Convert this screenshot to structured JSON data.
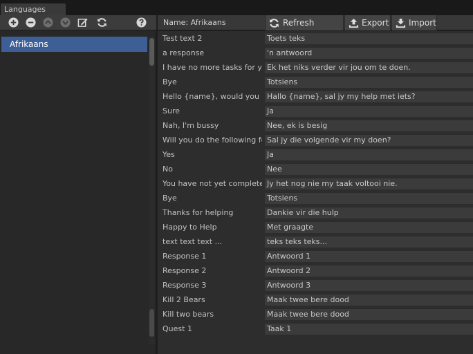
{
  "window": {
    "tab_label": "Languages"
  },
  "left_toolbar": {
    "icons": [
      "add-icon",
      "remove-icon",
      "move-up-icon",
      "move-down-icon",
      "edit-icon",
      "refresh-icon",
      "help-icon"
    ]
  },
  "languages": [
    "Afrikaans"
  ],
  "header": {
    "name_label": "Name:  Afrikaans",
    "refresh_label": "Refresh Strings",
    "export_label": "Export",
    "import_label": "Import"
  },
  "rows": [
    {
      "key": "Test text 2",
      "value": "Toets teks"
    },
    {
      "key": "a response",
      "value": "'n antwoord"
    },
    {
      "key": "I have no more tasks for you to do.",
      "value": "Ek het niks verder vir jou om te doen."
    },
    {
      "key": "Bye",
      "value": "Totsiens"
    },
    {
      "key": "Hello {name}, would you help me with something?",
      "value": "Hallo {name}, sal jy my help met iets?"
    },
    {
      "key": "Sure",
      "value": "Ja"
    },
    {
      "key": "Nah, I'm bussy",
      "value": "Nee, ek is besig"
    },
    {
      "key": "Will you do the following for me?",
      "value": "Sal jy die volgende vir my doen?"
    },
    {
      "key": "Yes",
      "value": "Ja"
    },
    {
      "key": "No",
      "value": "Nee"
    },
    {
      "key": "You have not yet completed my task.",
      "value": "Jy het nog nie my taak voltooi nie."
    },
    {
      "key": "Bye",
      "value": "Totsiens"
    },
    {
      "key": "Thanks for helping",
      "value": "Dankie vir die hulp"
    },
    {
      "key": "Happy to Help",
      "value": "Met graagte"
    },
    {
      "key": "text text text ...",
      "value": "teks teks teks..."
    },
    {
      "key": "Response 1",
      "value": "Antwoord 1"
    },
    {
      "key": "Response 2",
      "value": "Antwoord 2"
    },
    {
      "key": "Response 3",
      "value": "Antwoord 3"
    },
    {
      "key": "Kill 2 Bears",
      "value": "Maak twee bere dood"
    },
    {
      "key": "Kill two bears",
      "value": "Maak twee bere dood"
    },
    {
      "key": "Quest 1",
      "value": "Taak 1"
    }
  ]
}
